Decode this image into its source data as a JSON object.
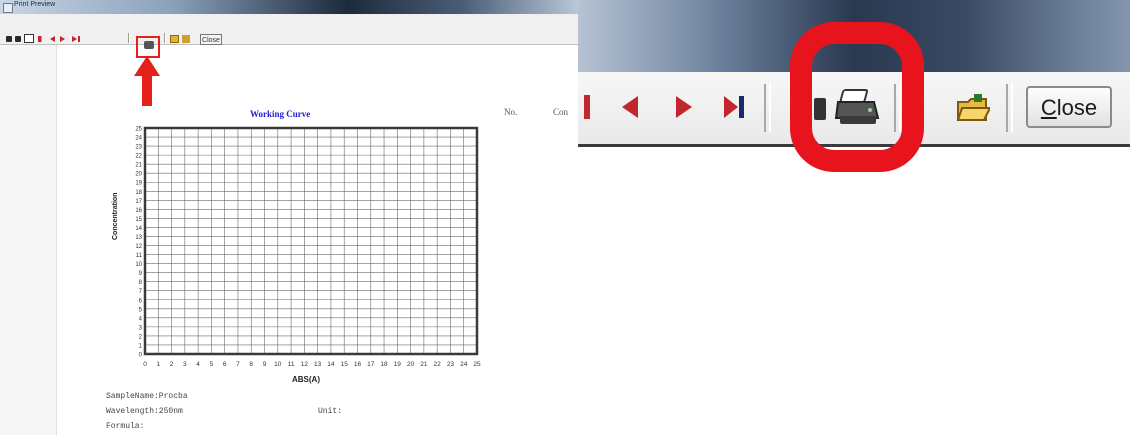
{
  "left_window": {
    "title": "Print Preview",
    "toolbar": {
      "close_label": "Close"
    },
    "report": {
      "title": "Working Curve",
      "no_label": "No.",
      "con_label": "Con",
      "y_axis_label": "Concentration",
      "x_axis_label": "ABS(A)",
      "x_ticks": [
        "0",
        "1",
        "2",
        "3",
        "4",
        "5",
        "6",
        "7",
        "8",
        "9",
        "10",
        "11",
        "12",
        "13",
        "14",
        "15",
        "16",
        "17",
        "18",
        "19",
        "20",
        "21",
        "22",
        "23",
        "24",
        "25"
      ],
      "y_ticks": [
        "25",
        "24",
        "23",
        "22",
        "21",
        "20",
        "19",
        "18",
        "17",
        "16",
        "15",
        "14",
        "13",
        "12",
        "11",
        "10",
        "9",
        "8",
        "7",
        "6",
        "5",
        "4",
        "3",
        "2",
        "1",
        "0"
      ],
      "sample_name": "SampleName:Procba",
      "wavelength": "Wavelength:250nm",
      "unit": "Unit:",
      "formula": "Formula:"
    },
    "highlight_color": "#e32119"
  },
  "zoom_panel": {
    "close_label": "Close",
    "close_mnemonic": "C",
    "close_rest": "lose",
    "highlight_color": "#e8141d"
  },
  "icons": {
    "print": "printer-icon",
    "open": "open-folder-icon",
    "first": "first-page-icon",
    "prev": "previous-page-icon",
    "next": "next-page-icon",
    "last": "last-page-icon"
  }
}
